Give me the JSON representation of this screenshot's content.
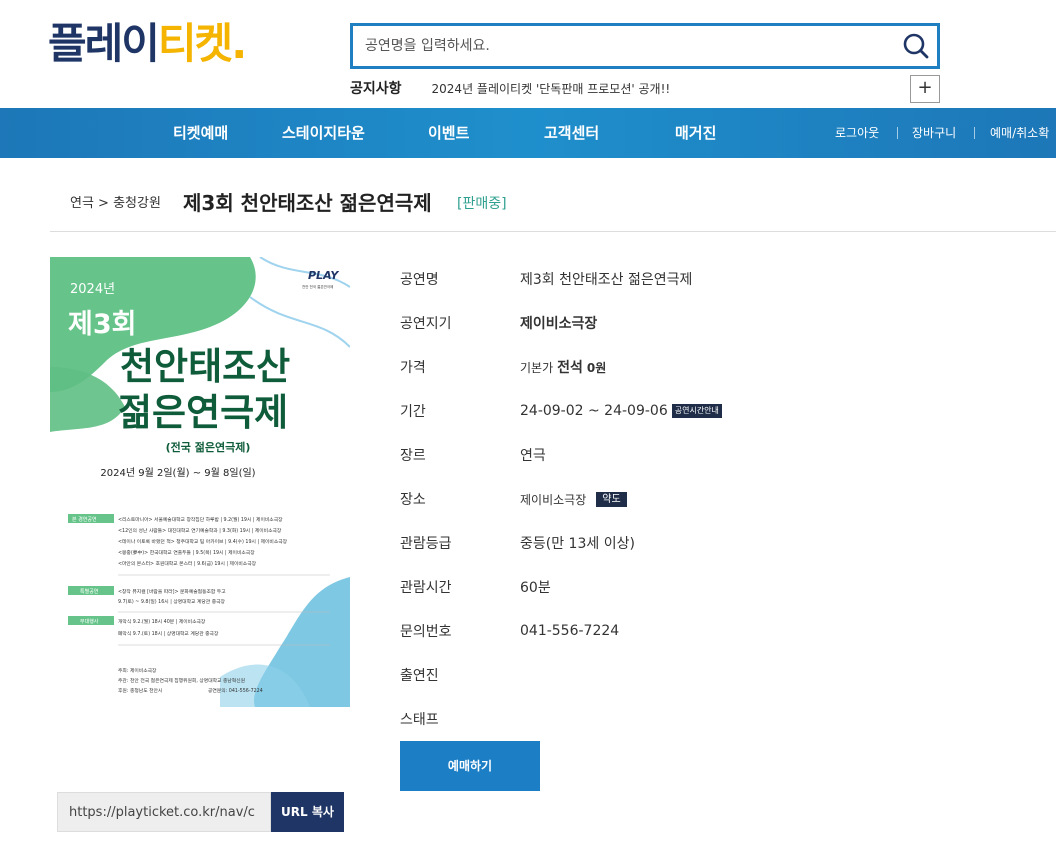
{
  "header": {
    "logo": {
      "part1": "플레이",
      "part2": "티켓",
      "dot": "."
    },
    "search": {
      "placeholder": "공연명을 입력하세요."
    },
    "notice": {
      "label": "공지사항",
      "text": "2024년 플레이티켓 '단독판매 프로모션' 공개!!",
      "more": "+"
    }
  },
  "nav": {
    "items": [
      "티켓예매",
      "스테이지타운",
      "이벤트",
      "고객센터",
      "매거진"
    ],
    "util": [
      "로그아웃",
      "장바구니",
      "예매/취소확"
    ]
  },
  "title_row": {
    "breadcrumb": "연극 > 충청강원",
    "title": "제3회 천안태조산 젊은연극제",
    "status": "[판매중]"
  },
  "poster": {
    "year": "2024년",
    "edition": "제3회",
    "main1": "천안태조산",
    "main2": "젊은연극제",
    "sub": "(전국 젊은연극제)",
    "dates": "2024년 9월 2일(월) ~ 9월 8일(일)",
    "brand": "PLAY",
    "brand_sub": "천안 전국 젊은연극제",
    "lines": [
      "<리스토마니아> 서울예술대학교 창작집단 하루밤 | 9.2(월) 19시 | 제이비소극장",
      "<12인의 성난 사람들> 대진대학교 연기예술학과 | 9.3(화) 19시 | 제이비소극장",
      "<테이나 이토록 바랬던 적> 청주대학교 팀 아카이브 | 9.4(수) 19시 | 제이비소극장",
      "<몽중(夢中)> 한국대학교 연출두들 | 9.5(목) 19시 | 제이비소극장",
      "<마안의 몬스터> 호원대학교 몬스터 | 9.6(금) 19시 | 제이비소극장",
      "<창작 뮤지컬 [바람을 따라]> 문화예술협동조합 두고",
      "9.7(토) ~ 9.8(일) 16시 | 상명대학교 계당관 중극장",
      "개막식 9.2.(월) 18시 40분 | 제이비소극장",
      "폐막식 9.7.(토) 18시 | 상명대학교 계당관 중극장",
      "주최: 제이비소극장",
      "주관: 천안 전국 젊은연극제 집행위원회, 상명대학교 충남혁신원",
      "후원: 충청남도 천안시",
      "공연문의: 041-556-7224"
    ],
    "section_tags": [
      "본 경연공연",
      "특별공연",
      "부대행사"
    ]
  },
  "url": {
    "value": "https://playticket.co.kr/nav/c",
    "copy_label": "URL 복사"
  },
  "info": {
    "rows": [
      {
        "label": "공연명",
        "value": "제3회 천안태조산 젊은연극제"
      },
      {
        "label": "공연지기",
        "value": "제이비소극장"
      },
      {
        "label": "가격",
        "prefix": "기본가",
        "seat": "전석",
        "price": "0원"
      },
      {
        "label": "기간",
        "value": "24-09-02 ~ 24-09-06",
        "tag": "공연시간안내"
      },
      {
        "label": "장르",
        "value": "연극"
      },
      {
        "label": "장소",
        "value": "제이비소극장",
        "tag": "약도"
      },
      {
        "label": "관람등급",
        "value": "중등(만 13세 이상)"
      },
      {
        "label": "관람시간",
        "value": "60분"
      },
      {
        "label": "문의번호",
        "value": "041-556-7224"
      },
      {
        "label": "출연진",
        "value": ""
      },
      {
        "label": "스태프",
        "value": ""
      }
    ],
    "reserve_label": "예매하기"
  },
  "colors": {
    "navy": "#1f3566",
    "yellow": "#f4b400",
    "nav_blue": "#1a86c8",
    "accent_green": "#2fa08f",
    "poster_green": "#1f9a5c"
  }
}
